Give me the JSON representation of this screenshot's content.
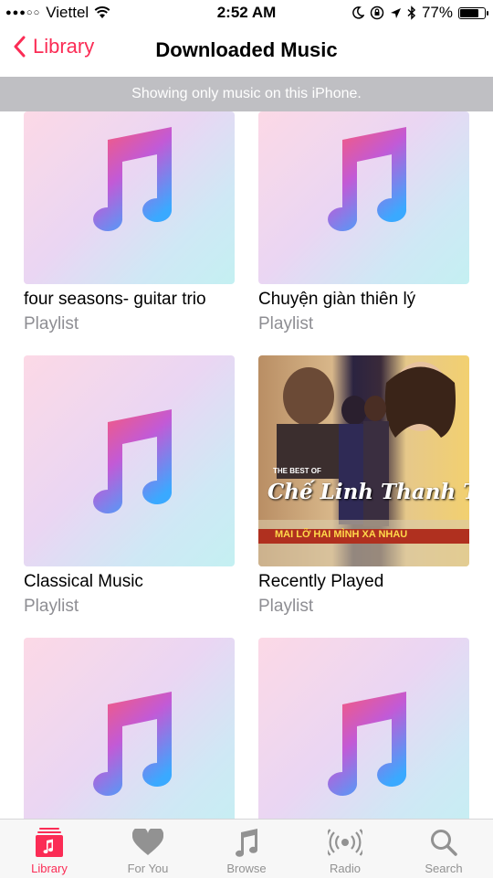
{
  "status": {
    "carrier": "Viettel",
    "signal_dots": "●●●○○",
    "time": "2:52 AM",
    "battery": "77%",
    "battery_level": 0.77
  },
  "nav": {
    "back_label": "Library",
    "title": "Downloaded Music"
  },
  "banner": "Showing only music on this iPhone.",
  "items": [
    {
      "name": "four seasons- guitar trio",
      "type": "Playlist"
    },
    {
      "name": "Chuyện giàn thiên lý",
      "type": "Playlist"
    },
    {
      "name": "Classical Music",
      "type": "Playlist"
    },
    {
      "name": "Recently Played",
      "type": "Playlist",
      "cover": {
        "line1": "THE BEST OF",
        "line2": "Chế Linh Thanh Tuyền",
        "line3": "MAI LỠ HAI MÌNH XA NHAU"
      }
    },
    {
      "name": "",
      "type": ""
    },
    {
      "name": "",
      "type": ""
    }
  ],
  "tabs": [
    {
      "label": "Library",
      "icon": "library-icon",
      "active": true
    },
    {
      "label": "For You",
      "icon": "heart-icon",
      "active": false
    },
    {
      "label": "Browse",
      "icon": "music-note-icon",
      "active": false
    },
    {
      "label": "Radio",
      "icon": "radio-icon",
      "active": false
    },
    {
      "label": "Search",
      "icon": "search-icon",
      "active": false
    }
  ],
  "colors": {
    "accent": "#fb2c55",
    "inactive": "#929292",
    "banner": "#bfbfc3"
  }
}
